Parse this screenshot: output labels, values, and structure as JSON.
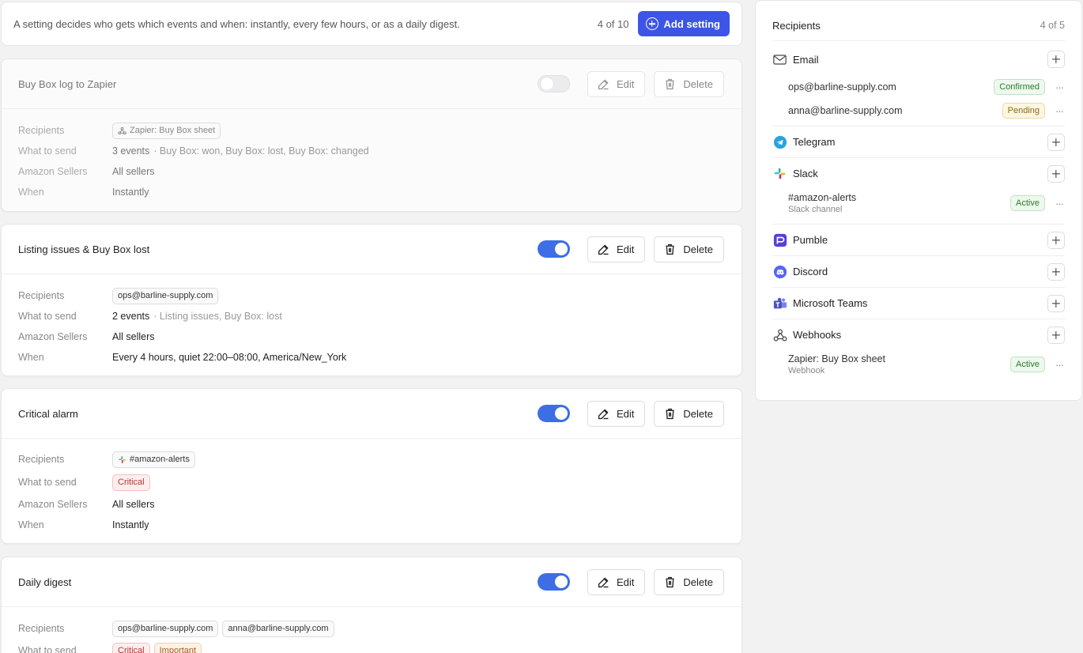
{
  "infobar": {
    "description": "A setting decides who gets which events and when: instantly, every few hours, or as a daily digest.",
    "count": "4 of 10",
    "add_label": "Add setting"
  },
  "labels": {
    "recipients": "Recipients",
    "what": "What to send",
    "sellers": "Amazon Sellers",
    "when": "When",
    "edit": "Edit",
    "delete": "Delete"
  },
  "settings": [
    {
      "title": "Buy Box log to Zapier",
      "enabled": false,
      "recipient_chips": [
        "Zapier: Buy Box sheet"
      ],
      "what_count": "3 events",
      "what_detail": "· Buy Box: won, Buy Box: lost, Buy Box: changed",
      "sellers": "All sellers",
      "when": "Instantly"
    },
    {
      "title": "Listing issues & Buy Box lost",
      "enabled": true,
      "recipient_chips": [
        "ops@barline-supply.com"
      ],
      "what_count": "2 events",
      "what_detail": "· Listing issues, Buy Box: lost",
      "sellers": "All sellers",
      "when": "Every 4 hours, quiet 22:00–08:00, America/New_York"
    },
    {
      "title": "Critical alarm",
      "enabled": true,
      "recipient_chips": [
        "#amazon-alerts"
      ],
      "what_tags": [
        "Critical"
      ],
      "sellers": "All sellers",
      "when": "Instantly"
    },
    {
      "title": "Daily digest",
      "enabled": true,
      "recipient_chips": [
        "ops@barline-supply.com",
        "anna@barline-supply.com"
      ],
      "what_tags": [
        "Critical",
        "Important"
      ]
    }
  ],
  "sidebar": {
    "title": "Recipients",
    "count": "4 of 5",
    "channels": {
      "email": {
        "name": "Email",
        "items": [
          {
            "value": "ops@barline-supply.com",
            "status": "Confirmed"
          },
          {
            "value": "anna@barline-supply.com",
            "status": "Pending"
          }
        ]
      },
      "telegram": {
        "name": "Telegram"
      },
      "slack": {
        "name": "Slack",
        "items": [
          {
            "value": "#amazon-alerts",
            "sub": "Slack channel",
            "status": "Active"
          }
        ]
      },
      "pumble": {
        "name": "Pumble"
      },
      "discord": {
        "name": "Discord"
      },
      "teams": {
        "name": "Microsoft Teams"
      },
      "webhooks": {
        "name": "Webhooks",
        "items": [
          {
            "value": "Zapier: Buy Box sheet",
            "sub": "Webhook",
            "status": "Active"
          }
        ]
      }
    }
  },
  "colors": {
    "primary": "#3d55e6",
    "toggle_on": "#3d6ee6",
    "telegram": "#2aa3df",
    "pumble": "#5b3fd4",
    "discord": "#5865f2",
    "teams": "#4b53bc"
  },
  "icons": {
    "add": "plus-circle-icon",
    "edit": "pencil-icon",
    "delete": "trash-icon",
    "email": "envelope-icon",
    "webhook": "webhook-icon"
  }
}
